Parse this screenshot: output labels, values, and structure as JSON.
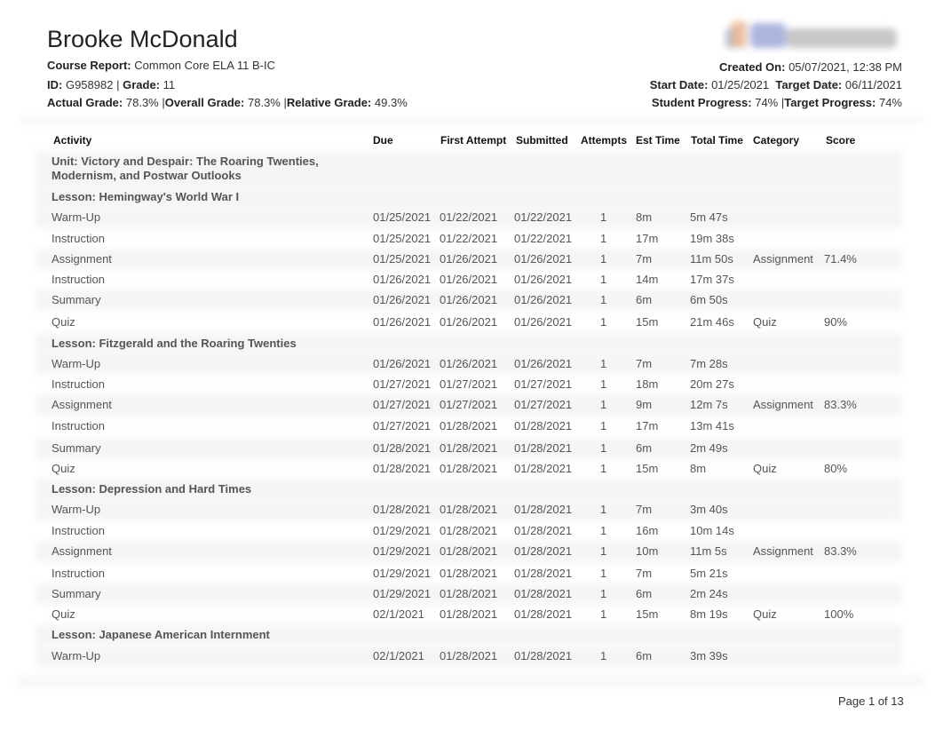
{
  "student": {
    "name": "Brooke McDonald",
    "course_report_label": "Course Report:",
    "course_report": "Common Core ELA 11 B-IC",
    "id_label": "ID:",
    "id": "G958982",
    "grade_label": "Grade:",
    "grade": "11",
    "actual_grade_label": "Actual Grade:",
    "actual_grade": "78.3%",
    "overall_grade_label": "Overall Grade:",
    "overall_grade": "78.3%",
    "relative_grade_label": "Relative Grade:",
    "relative_grade": "49.3%",
    "separator": "|"
  },
  "report": {
    "logo_icon": "edgenuity-logo-icon",
    "created_on_label": "Created On:",
    "created_on": "05/07/2021, 12:38 PM",
    "start_date_label": "Start Date:",
    "start_date": "01/25/2021",
    "target_date_label": "Target Date:",
    "target_date": "06/11/2021",
    "student_progress_label": "Student Progress:",
    "student_progress": "74%",
    "target_progress_label": "Target Progress:",
    "target_progress": "74%"
  },
  "table": {
    "headers": {
      "activity": "Activity",
      "due": "Due",
      "first_attempt": "First Attempt",
      "submitted": "Submitted",
      "attempts": "Attempts",
      "est_time": "Est Time",
      "total_time": "Total Time",
      "category": "Category",
      "score": "Score"
    },
    "unit": {
      "line1": "Unit: Victory and Despair: The Roaring Twenties,",
      "line2": "Modernism, and Postwar Outlooks"
    },
    "lessons": [
      {
        "title": "Lesson: Hemingway's World War I",
        "rows": [
          {
            "activity": "Warm-Up",
            "due": "01/25/2021",
            "first": "01/22/2021",
            "submitted": "01/22/2021",
            "attempts": "1",
            "est": "8m",
            "total": "5m 47s",
            "category": "",
            "score": ""
          },
          {
            "activity": "Instruction",
            "due": "01/25/2021",
            "first": "01/22/2021",
            "submitted": "01/22/2021",
            "attempts": "1",
            "est": "17m",
            "total": "19m 38s",
            "category": "",
            "score": ""
          },
          {
            "activity": "Assignment",
            "due": "01/25/2021",
            "first": "01/26/2021",
            "submitted": "01/26/2021",
            "attempts": "1",
            "est": "7m",
            "total": "11m 50s",
            "category": "Assignment",
            "score": "71.4%"
          },
          {
            "activity": "Instruction",
            "due": "01/26/2021",
            "first": "01/26/2021",
            "submitted": "01/26/2021",
            "attempts": "1",
            "est": "14m",
            "total": "17m 37s",
            "category": "",
            "score": ""
          },
          {
            "activity": "Summary",
            "due": "01/26/2021",
            "first": "01/26/2021",
            "submitted": "01/26/2021",
            "attempts": "1",
            "est": "6m",
            "total": "6m 50s",
            "category": "",
            "score": ""
          },
          {
            "activity": "Quiz",
            "due": "01/26/2021",
            "first": "01/26/2021",
            "submitted": "01/26/2021",
            "attempts": "1",
            "est": "15m",
            "total": "21m 46s",
            "category": "Quiz",
            "score": "90%"
          }
        ]
      },
      {
        "title": "Lesson: Fitzgerald and the Roaring Twenties",
        "rows": [
          {
            "activity": "Warm-Up",
            "due": "01/26/2021",
            "first": "01/26/2021",
            "submitted": "01/26/2021",
            "attempts": "1",
            "est": "7m",
            "total": "7m 28s",
            "category": "",
            "score": ""
          },
          {
            "activity": "Instruction",
            "due": "01/27/2021",
            "first": "01/27/2021",
            "submitted": "01/27/2021",
            "attempts": "1",
            "est": "18m",
            "total": "20m 27s",
            "category": "",
            "score": ""
          },
          {
            "activity": "Assignment",
            "due": "01/27/2021",
            "first": "01/27/2021",
            "submitted": "01/27/2021",
            "attempts": "1",
            "est": "9m",
            "total": "12m 7s",
            "category": "Assignment",
            "score": "83.3%"
          },
          {
            "activity": "Instruction",
            "due": "01/27/2021",
            "first": "01/28/2021",
            "submitted": "01/28/2021",
            "attempts": "1",
            "est": "17m",
            "total": "13m 41s",
            "category": "",
            "score": ""
          },
          {
            "activity": "Summary",
            "due": "01/28/2021",
            "first": "01/28/2021",
            "submitted": "01/28/2021",
            "attempts": "1",
            "est": "6m",
            "total": "2m 49s",
            "category": "",
            "score": ""
          },
          {
            "activity": "Quiz",
            "due": "01/28/2021",
            "first": "01/28/2021",
            "submitted": "01/28/2021",
            "attempts": "1",
            "est": "15m",
            "total": "8m",
            "category": "Quiz",
            "score": "80%"
          }
        ]
      },
      {
        "title": "Lesson: Depression and Hard Times",
        "rows": [
          {
            "activity": "Warm-Up",
            "due": "01/28/2021",
            "first": "01/28/2021",
            "submitted": "01/28/2021",
            "attempts": "1",
            "est": "7m",
            "total": "3m 40s",
            "category": "",
            "score": ""
          },
          {
            "activity": "Instruction",
            "due": "01/29/2021",
            "first": "01/28/2021",
            "submitted": "01/28/2021",
            "attempts": "1",
            "est": "16m",
            "total": "10m 14s",
            "category": "",
            "score": ""
          },
          {
            "activity": "Assignment",
            "due": "01/29/2021",
            "first": "01/28/2021",
            "submitted": "01/28/2021",
            "attempts": "1",
            "est": "10m",
            "total": "11m 5s",
            "category": "Assignment",
            "score": "83.3%"
          },
          {
            "activity": "Instruction",
            "due": "01/29/2021",
            "first": "01/28/2021",
            "submitted": "01/28/2021",
            "attempts": "1",
            "est": "7m",
            "total": "5m 21s",
            "category": "",
            "score": ""
          },
          {
            "activity": "Summary",
            "due": "01/29/2021",
            "first": "01/28/2021",
            "submitted": "01/28/2021",
            "attempts": "1",
            "est": "6m",
            "total": "2m 24s",
            "category": "",
            "score": ""
          },
          {
            "activity": "Quiz",
            "due": "02/1/2021",
            "first": "01/28/2021",
            "submitted": "01/28/2021",
            "attempts": "1",
            "est": "15m",
            "total": "8m 19s",
            "category": "Quiz",
            "score": "100%"
          }
        ]
      },
      {
        "title": "Lesson: Japanese American Internment",
        "rows": [
          {
            "activity": "Warm-Up",
            "due": "02/1/2021",
            "first": "01/28/2021",
            "submitted": "01/28/2021",
            "attempts": "1",
            "est": "6m",
            "total": "3m 39s",
            "category": "",
            "score": ""
          }
        ]
      }
    ]
  },
  "footer": {
    "page_label": "Page 1 of 13"
  }
}
